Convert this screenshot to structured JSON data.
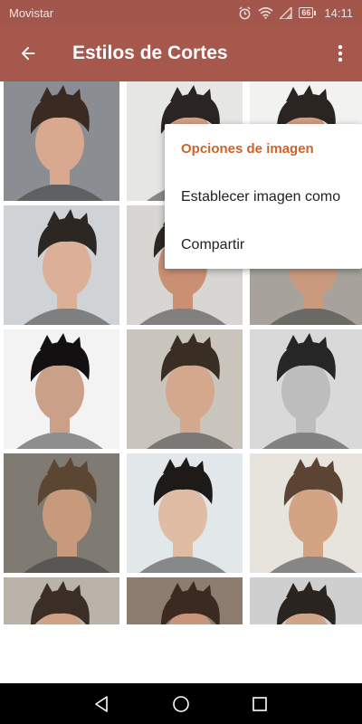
{
  "status_bar": {
    "carrier": "Movistar",
    "battery": "66",
    "time": "14:11",
    "icons": [
      "alarm-icon",
      "wifi-icon",
      "signal-icon",
      "battery-icon"
    ]
  },
  "app_bar": {
    "title": "Estilos de Cortes",
    "back_icon": "arrow-back-icon",
    "overflow_icon": "more-vert-icon",
    "color": "#a6584d"
  },
  "popup_menu": {
    "header": "Opciones de imagen",
    "header_color": "#c8642e",
    "items": [
      {
        "label": "Establecer imagen como"
      },
      {
        "label": "Compartir"
      }
    ]
  },
  "gallery": {
    "images": [
      {
        "name": "haircut-photo-1",
        "bg": "#8a8e92",
        "hair": "#3b2a22",
        "skin": "#d9a98f"
      },
      {
        "name": "haircut-photo-2",
        "bg": "#e6e6e4",
        "hair": "#2a2522",
        "skin": "#d2a083"
      },
      {
        "name": "haircut-photo-3",
        "bg": "#f2f2f0",
        "hair": "#2b2521",
        "skin": "#cf9d80"
      },
      {
        "name": "haircut-photo-4",
        "bg": "#cfd3d6",
        "hair": "#2d2723",
        "skin": "#dcb096"
      },
      {
        "name": "haircut-photo-5",
        "bg": "#d8d6d2",
        "hair": "#2e2621",
        "skin": "#c99074"
      },
      {
        "name": "haircut-photo-6",
        "bg": "#a7a39c",
        "hair": "#4a3a2c",
        "skin": "#c99a7e"
      },
      {
        "name": "haircut-photo-7",
        "bg": "#f3f3f3",
        "hair": "#121010",
        "skin": "#caa088"
      },
      {
        "name": "haircut-photo-8",
        "bg": "#c9c4bc",
        "hair": "#3a2d24",
        "skin": "#d4a88c"
      },
      {
        "name": "haircut-photo-9",
        "bg": "#d9d9d9",
        "hair": "#262626",
        "skin": "#bdbdbd"
      },
      {
        "name": "haircut-photo-10",
        "bg": "#7f7a72",
        "hair": "#5a4632",
        "skin": "#c79a7c"
      },
      {
        "name": "haircut-photo-11",
        "bg": "#e2e7ea",
        "hair": "#1e1a18",
        "skin": "#e0bca4"
      },
      {
        "name": "haircut-photo-12",
        "bg": "#e7e3dd",
        "hair": "#5b4433",
        "skin": "#d2a484"
      },
      {
        "name": "haircut-photo-13",
        "bg": "#b9b3aa",
        "hair": "#3a2e27",
        "skin": "#cfa286"
      },
      {
        "name": "haircut-photo-14",
        "bg": "#8c7d70",
        "hair": "#3a2a20",
        "skin": "#c9957a"
      },
      {
        "name": "haircut-photo-15",
        "bg": "#cfcfcf",
        "hair": "#2a2420",
        "skin": "#d0a487"
      }
    ]
  },
  "nav_bar": {
    "icons": [
      "nav-back-icon",
      "nav-home-icon",
      "nav-recents-icon"
    ]
  }
}
